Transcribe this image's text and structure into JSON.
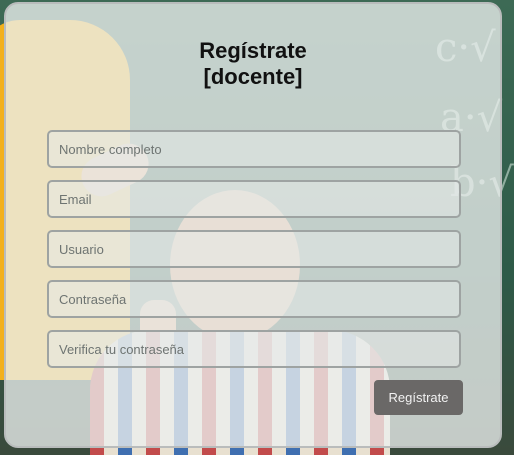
{
  "form": {
    "title_line1": "Regístrate",
    "title_line2": "[docente]",
    "fields": [
      {
        "placeholder": "Nombre completo",
        "value": ""
      },
      {
        "placeholder": "Email",
        "value": ""
      },
      {
        "placeholder": "Usuario",
        "value": ""
      },
      {
        "placeholder": "Contraseña",
        "value": ""
      },
      {
        "placeholder": "Verifica tu contraseña",
        "value": ""
      }
    ],
    "submit_label": "Regístrate"
  },
  "background": {
    "description_icon": "classroom-photo"
  }
}
